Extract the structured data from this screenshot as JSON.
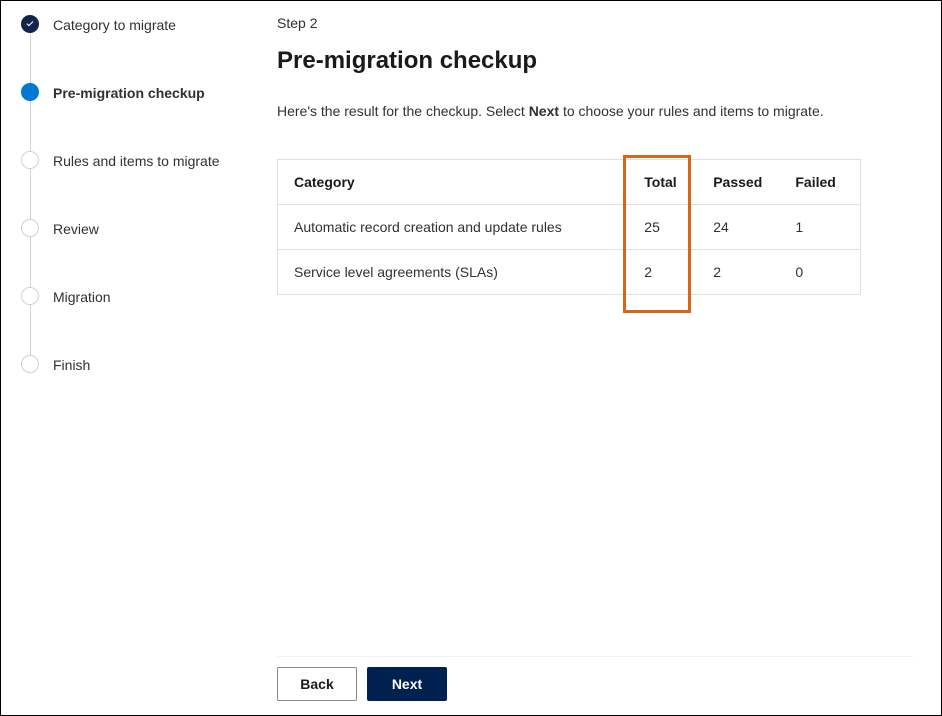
{
  "stepper": {
    "steps": [
      {
        "label": "Category to migrate",
        "state": "done"
      },
      {
        "label": "Pre-migration checkup",
        "state": "active"
      },
      {
        "label": "Rules and items to migrate",
        "state": "pending"
      },
      {
        "label": "Review",
        "state": "pending"
      },
      {
        "label": "Migration",
        "state": "pending"
      },
      {
        "label": "Finish",
        "state": "pending"
      }
    ]
  },
  "main": {
    "step_caption": "Step 2",
    "title": "Pre-migration checkup",
    "subtitle_pre": "Here's the result for the checkup. Select",
    "subtitle_bold": "Next",
    "subtitle_post": "to choose your rules and items to migrate."
  },
  "table": {
    "headers": {
      "category": "Category",
      "total": "Total",
      "passed": "Passed",
      "failed": "Failed"
    },
    "rows": [
      {
        "category": "Automatic record creation and update rules",
        "total": "25",
        "passed": "24",
        "failed": "1"
      },
      {
        "category": "Service level agreements (SLAs)",
        "total": "2",
        "passed": "2",
        "failed": "0"
      }
    ]
  },
  "footer": {
    "back": "Back",
    "next": "Next"
  }
}
